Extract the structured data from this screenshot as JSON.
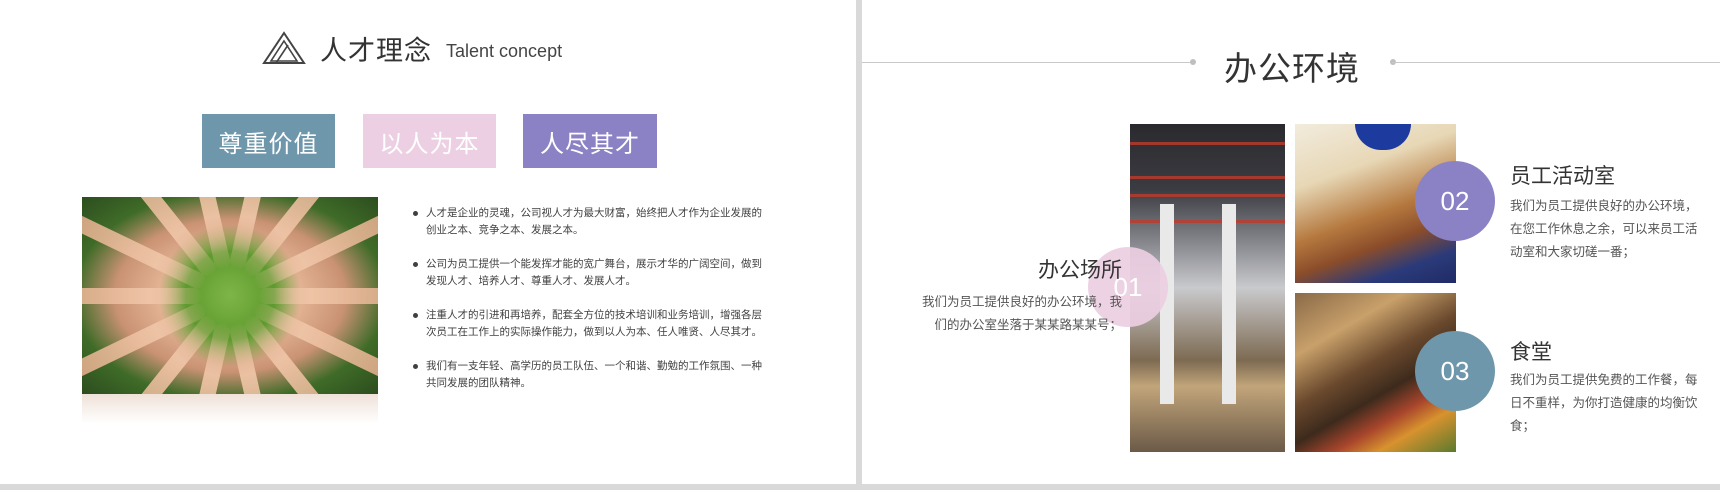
{
  "left_slide": {
    "title_cn": "人才理念",
    "title_en": "Talent concept",
    "logo_icon": "triangle-logo-icon",
    "values": [
      {
        "label": "尊重价值",
        "color": "#6f97ab"
      },
      {
        "label": "以人为本",
        "color": "#edcfe3"
      },
      {
        "label": "人尽其才",
        "color": "#8b82c6"
      }
    ],
    "bullets": [
      "人才是企业的灵魂，公司视人才为最大财富，始终把人才作为企业发展的创业之本、竞争之本、发展之本。",
      "公司为员工提供一个能发挥才能的宽广舞台，展示才华的广阔空间，做到发现人才、培养人才、尊重人才、发展人才。",
      "注重人才的引进和再培养，配套全方位的技术培训和业务培训，增强各层次员工在工作上的实际操作能力，做到以人为本、任人唯贤、人尽其才。",
      "我们有一支年轻、高学历的员工队伍、一个和谐、勤勉的工作氛围、一种共同发展的团队精神。"
    ]
  },
  "right_slide": {
    "title": "办公环境",
    "blocks": [
      {
        "number": "01",
        "title": "办公场所",
        "desc": "我们为员工提供良好的办公环境，我们的办公室坐落于某某路某某号；",
        "color": "#edcfe3"
      },
      {
        "number": "02",
        "title": "员工活动室",
        "desc": "我们为员工提供良好的办公环境，在您工作休息之余，可以来员工活动室和大家切磋一番；",
        "color": "#8b82c6"
      },
      {
        "number": "03",
        "title": "食堂",
        "desc": "我们为员工提供免费的工作餐，每日不重样，为你打造健康的均衡饮食；",
        "color": "#6f97ab"
      }
    ]
  }
}
